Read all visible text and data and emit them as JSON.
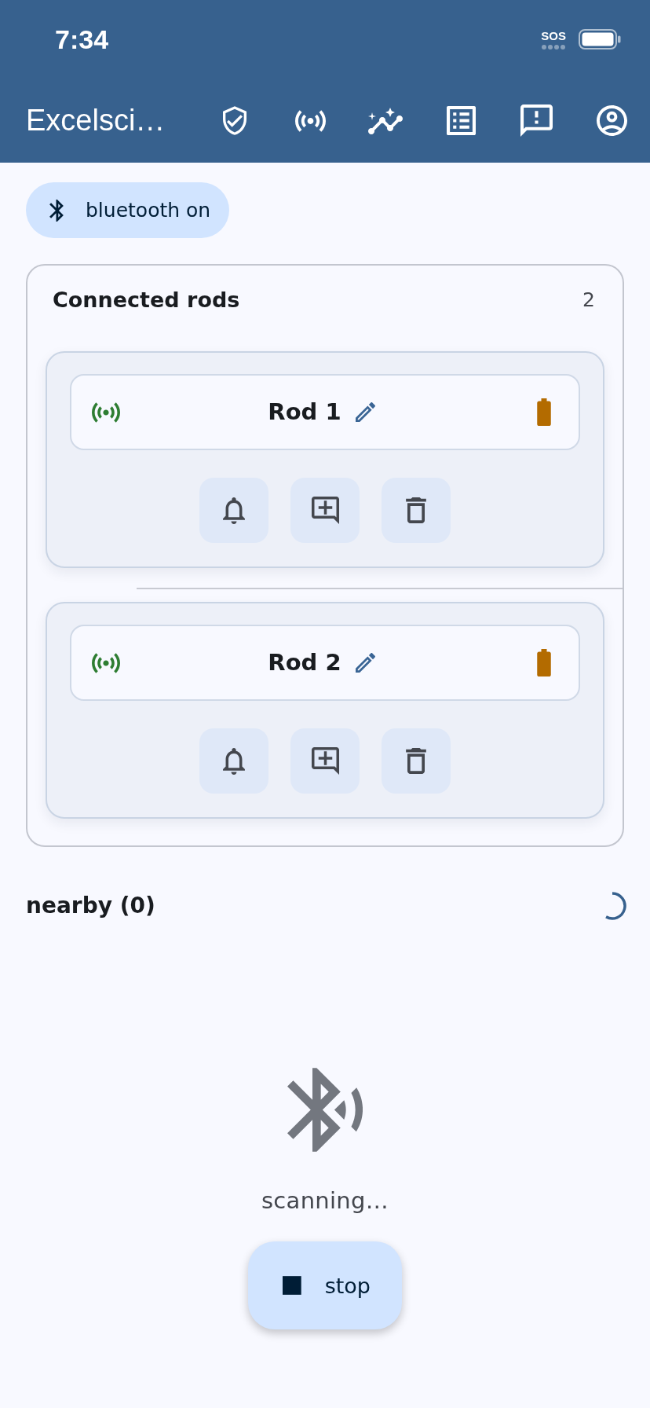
{
  "status_bar": {
    "time": "7:34",
    "network": "SOS"
  },
  "app_bar": {
    "title": "Excelsci…"
  },
  "bluetooth_chip": {
    "label": "bluetooth on"
  },
  "connected_rods": {
    "title": "Connected rods",
    "count": "2",
    "rods": [
      {
        "name": "Rod 1",
        "connected": true
      },
      {
        "name": "Rod 2",
        "connected": true
      }
    ]
  },
  "nearby": {
    "title": "nearby (0)"
  },
  "empty_state": {
    "message": "scanning…"
  },
  "stop_button": {
    "label": "stop"
  }
}
